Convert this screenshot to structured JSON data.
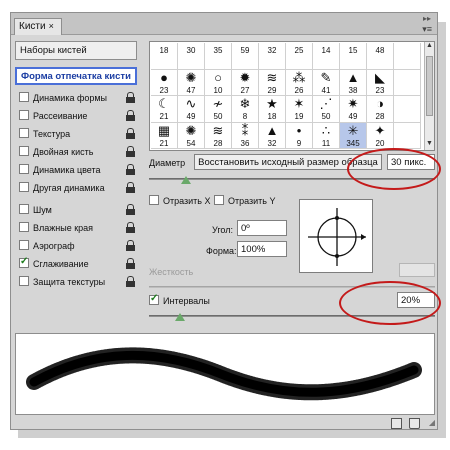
{
  "panel": {
    "tab_label": "Кисти",
    "close_glyph": "×",
    "collapse_glyph": "▸▸",
    "menu_glyph": "▾≡"
  },
  "left": {
    "presets_label": "Наборы кистей",
    "tip_shape_label": "Форма отпечатка кисти",
    "options": [
      {
        "label": "Динамика формы",
        "checked": false
      },
      {
        "label": "Рассеивание",
        "checked": false
      },
      {
        "label": "Текстура",
        "checked": false
      },
      {
        "label": "Двойная кисть",
        "checked": false
      },
      {
        "label": "Динамика цвета",
        "checked": false
      },
      {
        "label": "Другая динамика",
        "checked": false
      },
      {
        "label": "Шум",
        "checked": false
      },
      {
        "label": "Влажные края",
        "checked": false
      },
      {
        "label": "Аэрограф",
        "checked": false
      },
      {
        "label": "Сглаживание",
        "checked": true
      },
      {
        "label": "Защита текстуры",
        "checked": false
      }
    ]
  },
  "grid": {
    "cells": [
      {
        "num": "18",
        "glyph": ""
      },
      {
        "num": "30",
        "glyph": ""
      },
      {
        "num": "35",
        "glyph": ""
      },
      {
        "num": "59",
        "glyph": ""
      },
      {
        "num": "32",
        "glyph": ""
      },
      {
        "num": "25",
        "glyph": ""
      },
      {
        "num": "14",
        "glyph": ""
      },
      {
        "num": "15",
        "glyph": ""
      },
      {
        "num": "48",
        "glyph": ""
      },
      {
        "num": "",
        "glyph": ""
      },
      {
        "num": "23",
        "glyph": "●"
      },
      {
        "num": "47",
        "glyph": "✺"
      },
      {
        "num": "10",
        "glyph": "○"
      },
      {
        "num": "27",
        "glyph": "✹"
      },
      {
        "num": "29",
        "glyph": "≋"
      },
      {
        "num": "26",
        "glyph": "⁂"
      },
      {
        "num": "41",
        "glyph": "✎"
      },
      {
        "num": "38",
        "glyph": "▲"
      },
      {
        "num": "23",
        "glyph": "◣"
      },
      {
        "num": "",
        "glyph": ""
      },
      {
        "num": "21",
        "glyph": "☾"
      },
      {
        "num": "49",
        "glyph": "∿"
      },
      {
        "num": "50",
        "glyph": "≁"
      },
      {
        "num": "8",
        "glyph": "❄"
      },
      {
        "num": "18",
        "glyph": "★"
      },
      {
        "num": "19",
        "glyph": "✶"
      },
      {
        "num": "50",
        "glyph": "⋰"
      },
      {
        "num": "49",
        "glyph": "✷"
      },
      {
        "num": "28",
        "glyph": "◑"
      },
      {
        "num": "",
        "glyph": ""
      },
      {
        "num": "21",
        "glyph": "▦"
      },
      {
        "num": "54",
        "glyph": "✺"
      },
      {
        "num": "28",
        "glyph": "≋"
      },
      {
        "num": "36",
        "glyph": "⁑"
      },
      {
        "num": "32",
        "glyph": "▲"
      },
      {
        "num": "9",
        "glyph": "•"
      },
      {
        "num": "11",
        "glyph": "∴"
      },
      {
        "num": "345",
        "glyph": "✳"
      },
      {
        "num": "20",
        "glyph": "✦"
      },
      {
        "num": "",
        "glyph": ""
      }
    ],
    "selected_index": 37
  },
  "diameter": {
    "label": "Диаметр",
    "reset_button": "Восстановить исходный размер образца",
    "value": "30 пикс."
  },
  "flip": {
    "flip_x": "Отразить X",
    "flip_y": "Отразить Y"
  },
  "angle": {
    "label": "Угол:",
    "value": "0º"
  },
  "roundness": {
    "label": "Форма:",
    "value": "100%"
  },
  "hardness": {
    "label": "Жесткость"
  },
  "spacing": {
    "label": "Интервалы",
    "value": "20%",
    "checked": true
  },
  "colors": {
    "annotation": "#c41a1a",
    "selection": "#4a6fd8"
  },
  "icons": {
    "new": "new-brush-icon",
    "delete": "trash-icon"
  }
}
